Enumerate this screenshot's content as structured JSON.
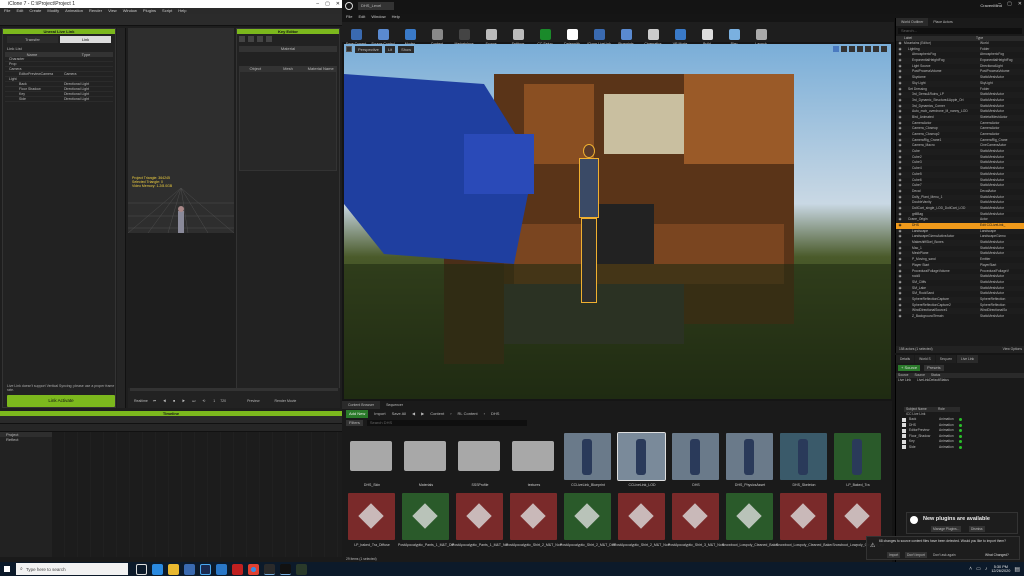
{
  "ic": {
    "title": "iClone 7 - C:\\iProject\\Project 1",
    "menu": [
      "File",
      "Edit",
      "Create",
      "Modify",
      "Animation",
      "Render",
      "View",
      "Window",
      "Plugins",
      "Script",
      "Help"
    ],
    "sidebar_title": "Animation Drive",
    "livelink_title": "Unreal Live Link",
    "tab_transfer": "Transfer",
    "tab_link": "Link",
    "livelink_label": "Link List",
    "col_name": "Name",
    "col_type": "Type",
    "tree": [
      {
        "name": "Character",
        "type": ""
      },
      {
        "name": "Prop",
        "type": ""
      },
      {
        "name": "Camera",
        "type": ""
      },
      {
        "name": "EditorPreviewCamera",
        "type": "Camera"
      },
      {
        "name": "Light",
        "type": ""
      },
      {
        "name": "Back",
        "type": "Directional Light"
      },
      {
        "name": "Floor Shadow",
        "type": "Directional Light"
      },
      {
        "name": "Key",
        "type": "Directional Light"
      },
      {
        "name": "Side",
        "type": "Directional Light"
      }
    ],
    "warning": "Live Link doesn't support Vertical Syncing; please use a proper frame rate.",
    "link_button": "Link Activate",
    "key_editor": "Key Editor",
    "material": "Material",
    "mat_cols": [
      "Object",
      "Mesh",
      "Material Name"
    ],
    "viewport_info": [
      "Project Triangle: 364245",
      "Selected Triangle: 0",
      "Video Memory: 1.2/8.0GB"
    ],
    "timeline_title": "Timeline",
    "transport": [
      "Realtime",
      "Preview",
      "Render Movie"
    ],
    "track_labels": [
      "Project",
      "Reflect"
    ],
    "current_frame": "1",
    "end_frame": "720"
  },
  "ue": {
    "tab": "DHS_Level",
    "user": "CravenMind",
    "menu": [
      "File",
      "Edit",
      "Window",
      "Help"
    ],
    "toolbar": [
      "Save Current",
      "Source Control",
      "Content",
      "Marketplace",
      "Settings",
      "Blueprints",
      "Cinematics",
      "Build",
      "Play",
      "Launch",
      "Settings",
      "Datasmith",
      "iClone LiveLink",
      "Blueprints",
      "Cinematics",
      "VR Mode",
      "Build",
      "Play",
      "Launch"
    ],
    "toolbar_visible": [
      "Save Current",
      "Source Control",
      "Modes",
      "Content",
      "Marketplace",
      "Source",
      "Settings",
      "CC Setup",
      "Datasmith",
      "iClone LiveLink",
      "Blueprints",
      "Cinematics",
      "VR Mode",
      "Build",
      "Play",
      "Launch"
    ],
    "vp_buttons": [
      "Perspective",
      "Lit",
      "Show"
    ],
    "outliner_title": "World Outliner",
    "place_actors": "Place Actors",
    "search_ph": "Search...",
    "col_label": "Label",
    "col_type": "Type",
    "outliner": [
      [
        "Mountains (Editor)",
        "World"
      ],
      [
        "Lighting",
        "Folder"
      ],
      [
        "AtmosphericFog",
        "AtmosphericFog"
      ],
      [
        "ExponentialHeightFog",
        "ExponentialHeightFog"
      ],
      [
        "Light Source",
        "DirectionalLight"
      ],
      [
        "PostProcessVolume",
        "PostProcessVolume"
      ],
      [
        "Skydome",
        "StaticMeshActor"
      ],
      [
        "Sky Light",
        "SkyLight"
      ],
      [
        "Set Dressing",
        "Folder"
      ],
      [
        "3rd_Demo&Ruins_LP",
        "StaticMeshActor"
      ],
      [
        "3rd_Dynamic_Structure&Apple_Ori",
        "StaticMeshActor"
      ],
      [
        "3rd_Dynamics_Corner",
        "StaticMeshActor"
      ],
      [
        "Auto_mob_overdrone_M_nanny_LOD",
        "StaticMeshActor"
      ],
      [
        "Bird_Animated",
        "SkeletalMeshActor"
      ],
      [
        "CameraActor",
        "CameraActor"
      ],
      [
        "Camera_Closeup",
        "CameraActor"
      ],
      [
        "Camera_Closeup2",
        "CameraActor"
      ],
      [
        "CameraRig_Crane1",
        "CameraRig_Crane"
      ],
      [
        "Camera_Macro",
        "CineCameraActor"
      ],
      [
        "Cube",
        "StaticMeshActor"
      ],
      [
        "Cube2",
        "StaticMeshActor"
      ],
      [
        "Cube3",
        "StaticMeshActor"
      ],
      [
        "Cube4",
        "StaticMeshActor"
      ],
      [
        "Cube5",
        "StaticMeshActor"
      ],
      [
        "Cube6",
        "StaticMeshActor"
      ],
      [
        "Cube7",
        "StaticMeshActor"
      ],
      [
        "Decal",
        "DecalActor"
      ],
      [
        "Dolly_Plant_Menu_1",
        "StaticMeshActor"
      ],
      [
        "DoubleVanity",
        "StaticMeshActor"
      ],
      [
        "DollCart_single_LOD_DollCart_LOD",
        "StaticMeshActor"
      ],
      [
        "grillBag",
        "StaticMeshActor"
      ],
      [
        "Crane_Origin",
        "Actor"
      ],
      [
        "DHS",
        "Edit CCLiveLink_"
      ],
      [
        "Landscape",
        "Landscape"
      ],
      [
        "LandscapeGizmoActiveActor",
        "LandscapeGizmo"
      ],
      [
        "MakeshiftSkel_Boxes",
        "StaticMeshActor"
      ],
      [
        "Mac_1",
        "StaticMeshActor"
      ],
      [
        "MeshPlane",
        "StaticMeshActor"
      ],
      [
        "P_Moving_sand",
        "Emitter"
      ],
      [
        "Player Start",
        "PlayerStart"
      ],
      [
        "ProceduralFoliageVolume",
        "ProceduralFoliageV"
      ],
      [
        "rock5",
        "StaticMeshActor"
      ],
      [
        "SM_Cliffs",
        "StaticMeshActor"
      ],
      [
        "SM_Lake",
        "StaticMeshActor"
      ],
      [
        "SM_RockSand",
        "StaticMeshActor"
      ],
      [
        "SphereReflectionCapture",
        "SphereReflection"
      ],
      [
        "SphereReflectionCapture2",
        "SphereReflection"
      ],
      [
        "WindDirectionalSource1",
        "WindDirectionalSo"
      ],
      [
        "Z_BackgroundTerrain",
        "StaticMeshActor"
      ]
    ],
    "actors_count": "158 actors (1 selected)",
    "view_options": "View Options",
    "details_tabs": [
      "Details",
      "World S",
      "Seq.uen",
      "Live Link"
    ],
    "source_btn": "+ Source",
    "presets": "Presets",
    "source_cols": [
      "Source",
      "Source",
      "Status"
    ],
    "source_row": "Live Link",
    "source_name": "LiveLinkDefaultStatus",
    "subject_cols": [
      "Subject Name",
      "Role"
    ],
    "subject_group": "iCC Live Link",
    "subjects": [
      [
        "Back",
        "Animation"
      ],
      [
        "DHS",
        "Animation"
      ],
      [
        "EditorPreview",
        "Animation"
      ],
      [
        "Floor_Shadow",
        "Animation"
      ],
      [
        "Key",
        "Animation"
      ],
      [
        "Side",
        "Animation"
      ]
    ],
    "cb_title": "Content Browser",
    "seq_title": "Sequencer",
    "add_new": "Add New",
    "import": "Import",
    "save_all": "Save All",
    "path": [
      "Content",
      "RL Content",
      "DHS"
    ],
    "filters": "Filters",
    "search_cb": "Search DHS",
    "assets_row1": [
      "DHS_Skin",
      "Materials",
      "SSSProfile",
      "textures",
      "CCLiveLink_Blueprint",
      "CCLiveLink_LOD",
      "DHS",
      "DHS_PhysicsAsset",
      "DHS_Skeleton",
      "LP_Baked_Tra"
    ],
    "assets_row2": [
      "LP_baked_Tra_Diffuse",
      "PostApocalyptic_Pants_1_M&T_Diffuse",
      "PostApocalyptic_Pants_1_M&T_Normal",
      "PostApocalyptic_Shirt_2_M&T_Normal",
      "PostApocalyptic_Shirt_2_M&T_Diffuse",
      "PostApocalyptic_Shirt_2_M&T_Normal",
      "PostApocalyptic_Shirt_3_M&T_Normal",
      "Snowboot_Lowpoly_Cleaned_Baked_Tra",
      "Snowboot_Lowpoly_Cleaned_Baked_Tra",
      "Snowboot_Lowpoly_Cleaned_Iro"
    ],
    "items_count": "29 items (1 selected)",
    "notif_title": "New plugins are available",
    "notif_btn1": "Manage Plugins...",
    "notif_btn2": "Dismiss",
    "notif2_text": "68 changes to source content files have been detected. Would you like to import them?",
    "notif2_btn1": "Import",
    "notif2_btn2": "Don't Import",
    "notif2_check": "Don't ask again",
    "notif2_link": "What Changed?"
  },
  "taskbar": {
    "search": "Type here to search",
    "time": "5:30 PM",
    "date": "12/26/2020"
  },
  "colors": {
    "accent": "#7cb81d",
    "ue_select": "#f09a1b",
    "ue_dark": "#151515"
  }
}
